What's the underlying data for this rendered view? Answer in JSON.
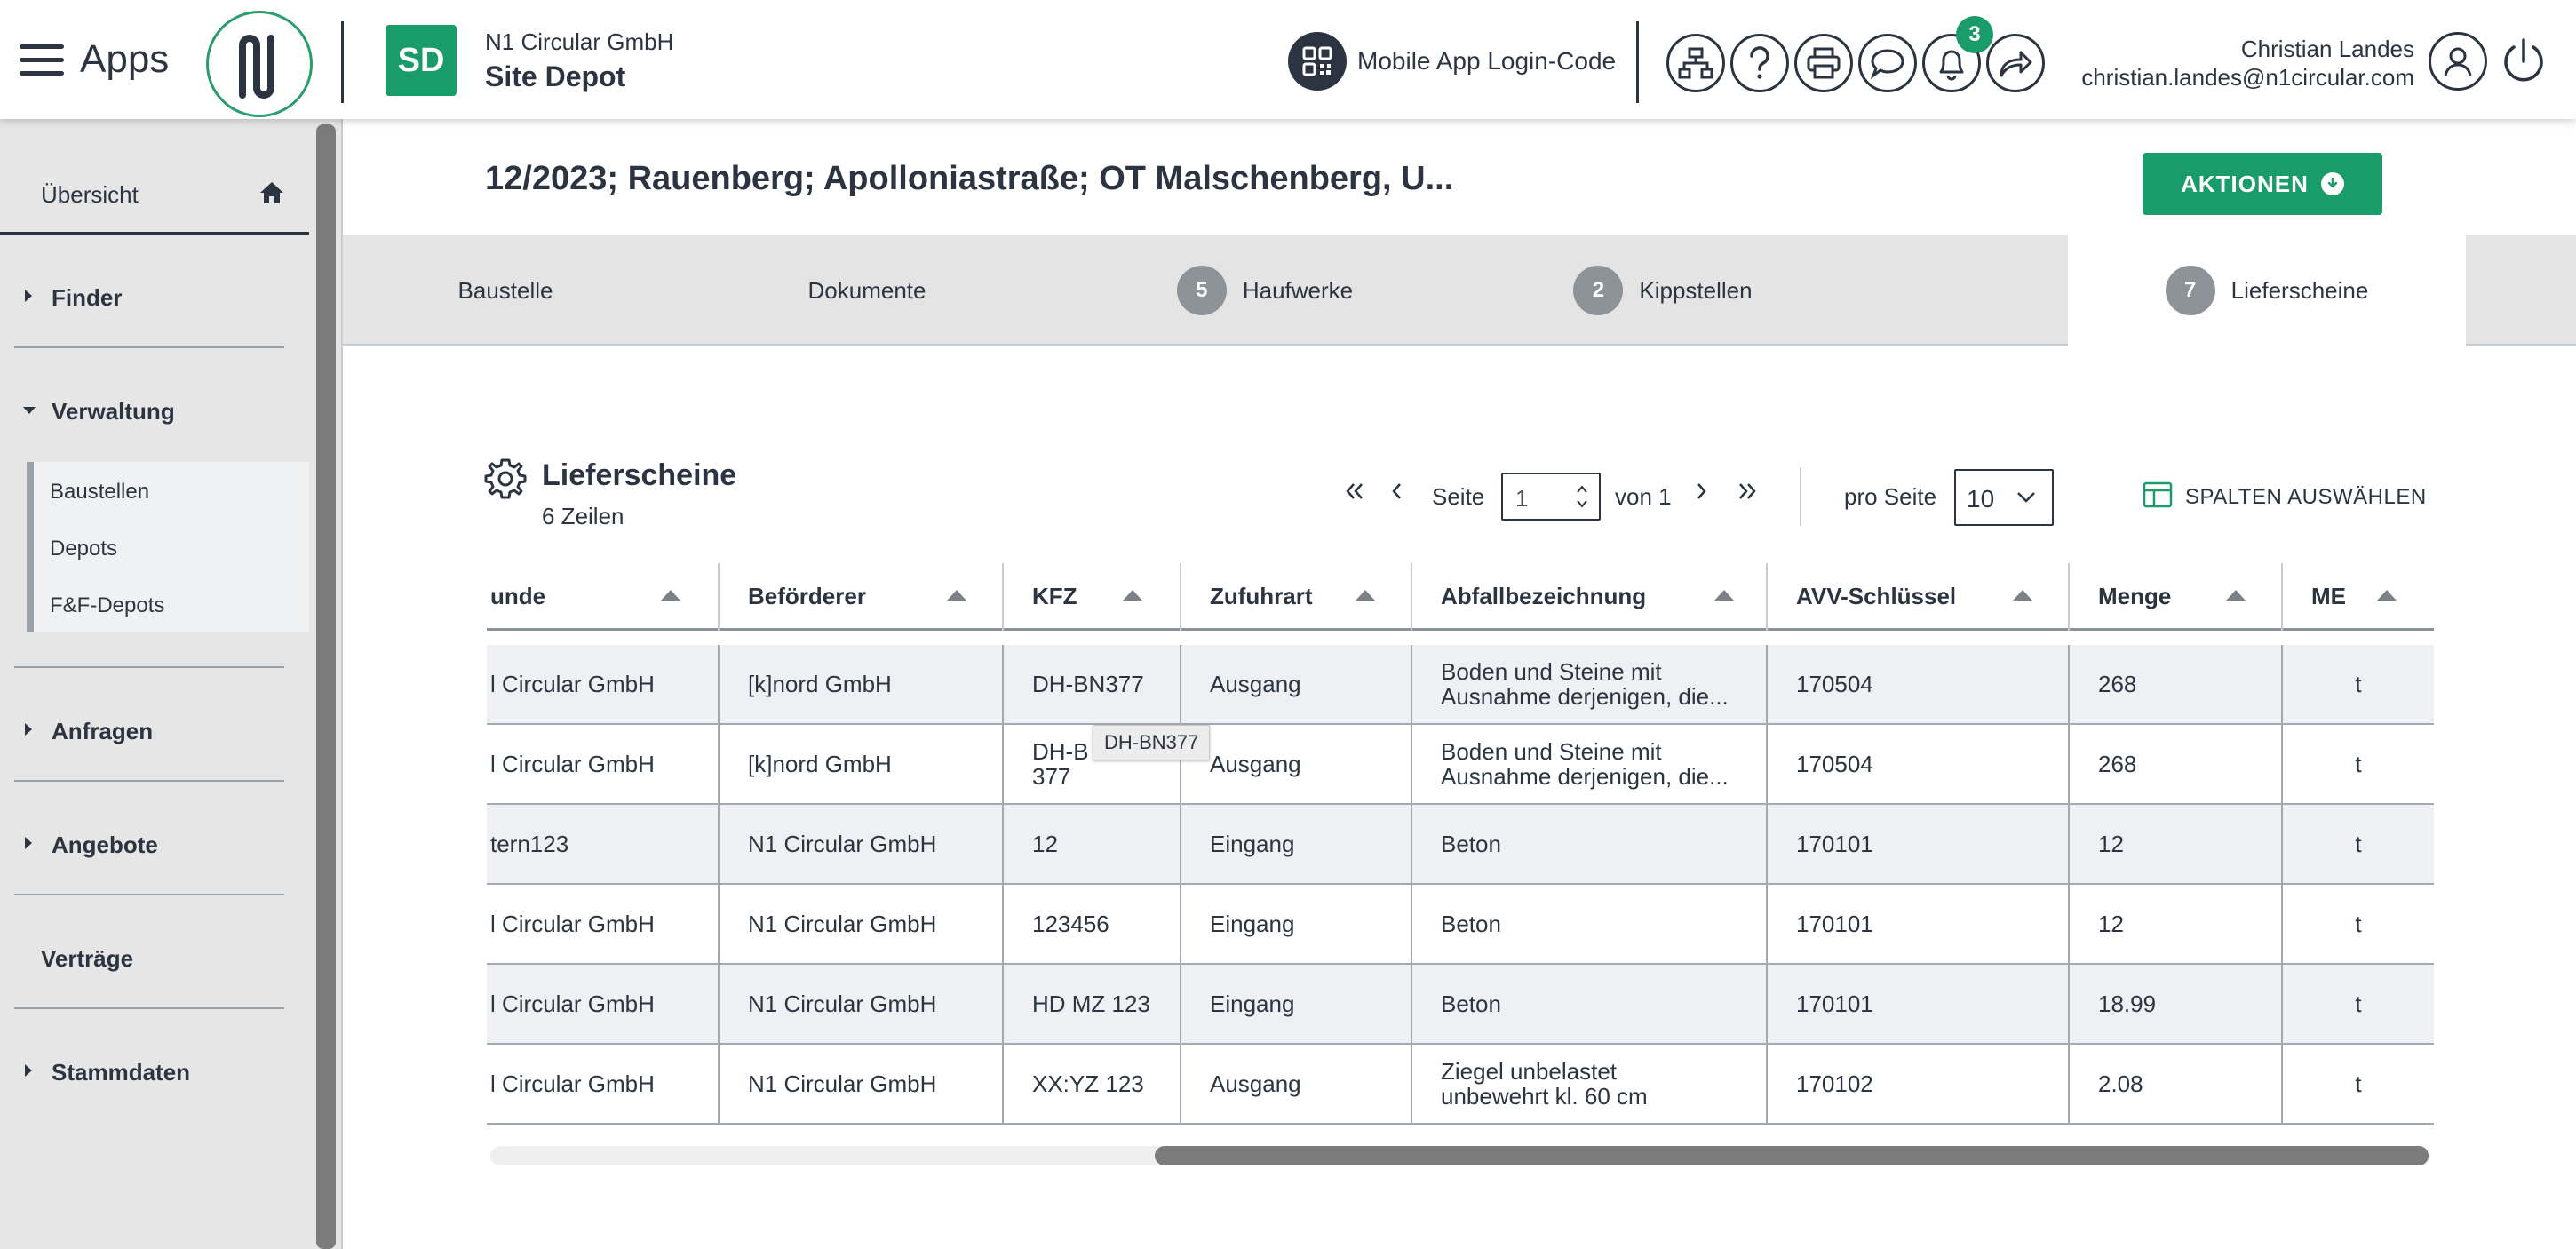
{
  "header": {
    "apps_label": "Apps",
    "sd_badge": "SD",
    "company": "N1 Circular GmbH",
    "site": "Site Depot",
    "mobile_login_label": "Mobile App Login-Code",
    "notifications_count": "3",
    "user_name": "Christian Landes",
    "user_email": "christian.landes@n1circular.com",
    "accent_color": "#1a9b6a"
  },
  "sidebar": {
    "overview": "Übersicht",
    "finder": "Finder",
    "verwaltung": "Verwaltung",
    "sub_items": [
      "Baustellen",
      "Depots",
      "F&F-Depots"
    ],
    "anfragen": "Anfragen",
    "angebote": "Angebote",
    "vertraege": "Verträge",
    "stammdaten": "Stammdaten"
  },
  "page": {
    "title": "12/2023; Rauenberg; Apolloniastraße; OT Malschenberg, U...",
    "actions_label": "AKTIONEN"
  },
  "tabs": [
    {
      "label": "Baustelle",
      "count": ""
    },
    {
      "label": "Dokumente",
      "count": ""
    },
    {
      "label": "Haufwerke",
      "count": "5"
    },
    {
      "label": "Kippstellen",
      "count": "2"
    },
    {
      "label": "Lieferscheine",
      "count": "7"
    }
  ],
  "table_section": {
    "title": "Lieferscheine",
    "row_count": "6 Zeilen",
    "page_label": "Seite",
    "page_value": "1",
    "of_label": "von 1",
    "per_page_label": "pro Seite",
    "per_page_value": "10",
    "columns_button": "SPALTEN AUSWÄHLEN"
  },
  "table": {
    "columns": [
      "unde",
      "Beförderer",
      "KFZ",
      "Zufuhrart",
      "Abfallbezeichnung",
      "AVV-Schlüssel",
      "Menge",
      "ME"
    ],
    "rows": [
      [
        "l Circular GmbH",
        "[k]nord GmbH",
        "DH-BN377",
        "Ausgang",
        "Boden und Steine mit Ausnahme derjenigen, die...",
        "170504",
        "268",
        "t"
      ],
      [
        "l Circular GmbH",
        "[k]nord GmbH",
        "DH-BN377",
        "Ausgang",
        "Boden und Steine mit Ausnahme derjenigen, die...",
        "170504",
        "268",
        "t"
      ],
      [
        "tern123",
        "N1 Circular GmbH",
        "12",
        "Eingang",
        "Beton",
        "170101",
        "12",
        "t"
      ],
      [
        "l Circular GmbH",
        "N1 Circular GmbH",
        "123456",
        "Eingang",
        "Beton",
        "170101",
        "12",
        "t"
      ],
      [
        "l Circular GmbH",
        "N1 Circular GmbH",
        "HD MZ 123",
        "Eingang",
        "Beton",
        "170101",
        "18.99",
        "t"
      ],
      [
        "l Circular GmbH",
        "N1 Circular GmbH",
        "XX:YZ 123",
        "Ausgang",
        "Ziegel unbelastet unbewehrt kl. 60 cm",
        "170102",
        "2.08",
        "t"
      ]
    ],
    "row2_kfz_display": "DH-B 377",
    "tooltip": "DH-BN377"
  }
}
